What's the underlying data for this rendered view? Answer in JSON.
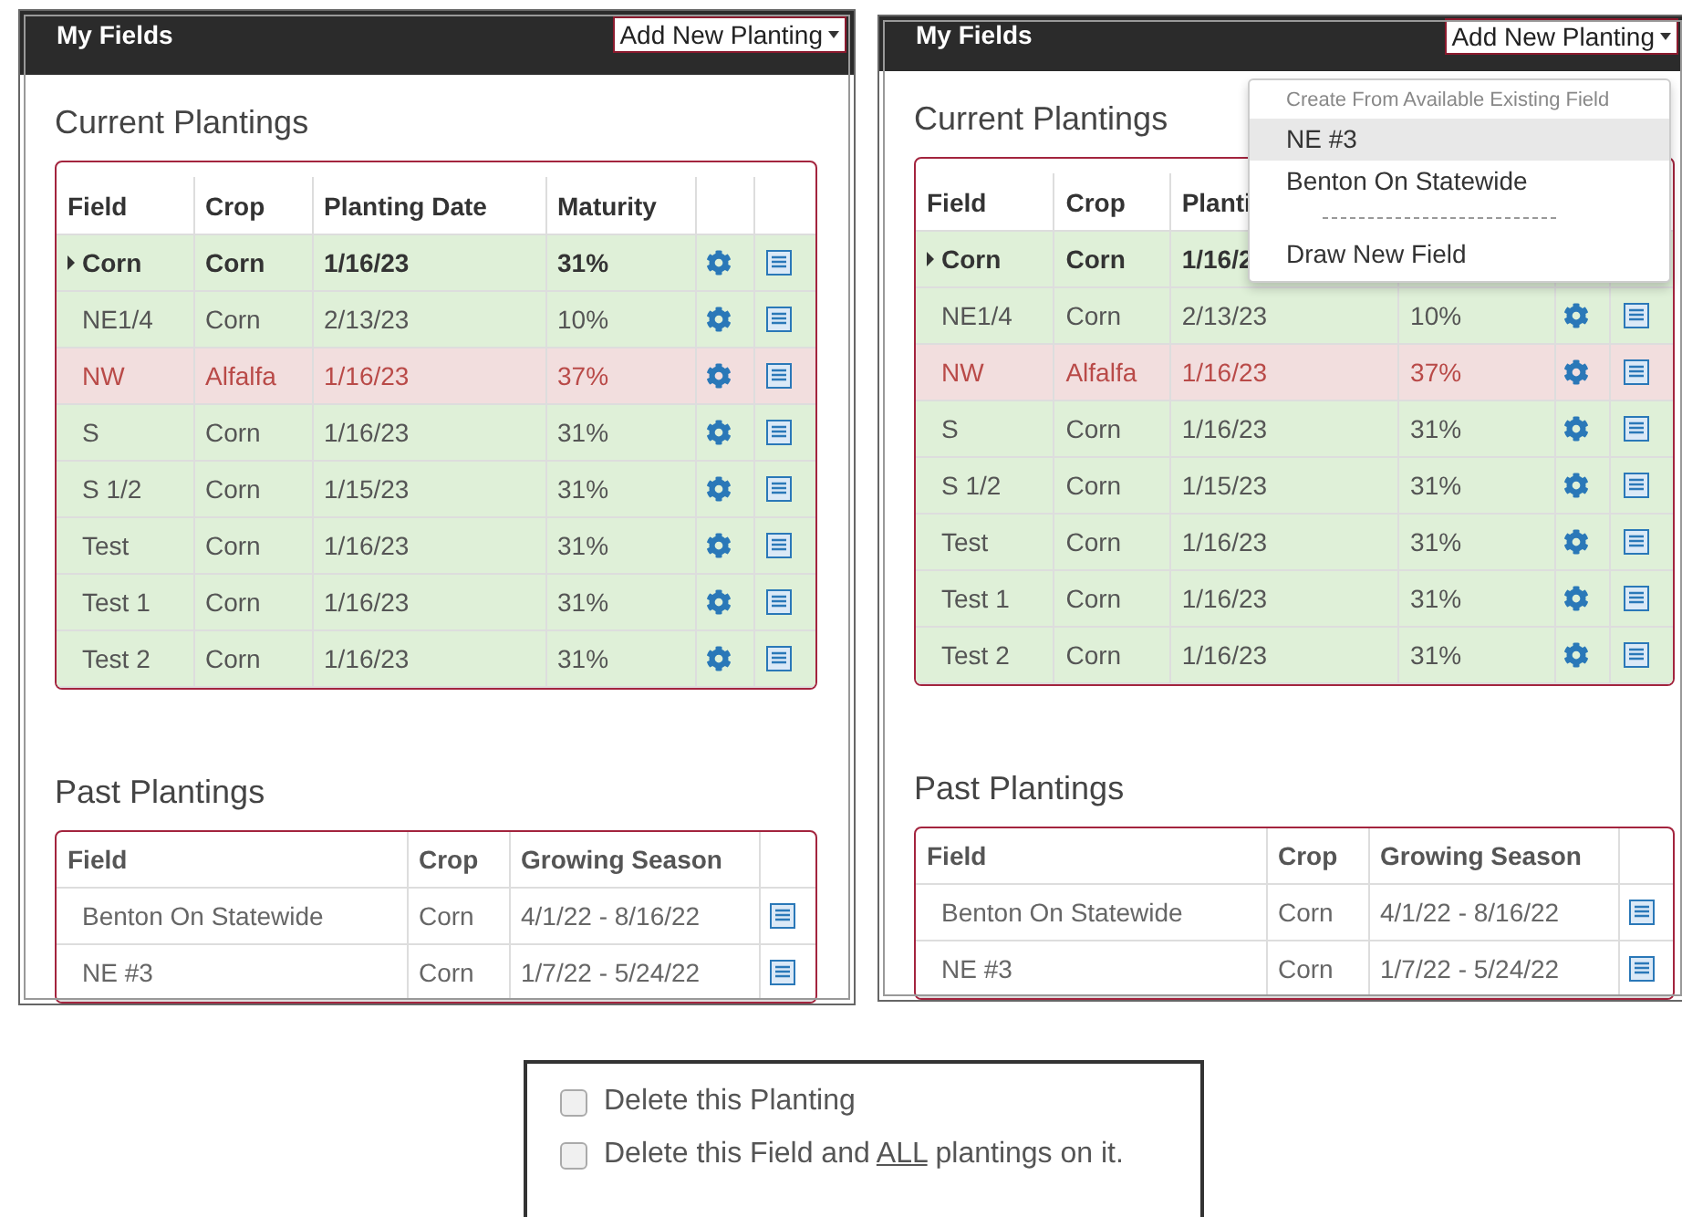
{
  "panels": [
    {
      "title": "My Fields",
      "add_button": "Add New Planting",
      "current": {
        "heading": "Current Plantings",
        "columns": [
          "Field",
          "Crop",
          "Planting Date",
          "Maturity"
        ],
        "rows": [
          {
            "field": "Corn",
            "crop": "Corn",
            "date": "1/16/23",
            "maturity": "31%",
            "color": "#dff0d8",
            "selected": true
          },
          {
            "field": "NE1/4",
            "crop": "Corn",
            "date": "2/13/23",
            "maturity": "10%",
            "color": "#dff0d8",
            "selected": false
          },
          {
            "field": "NW",
            "crop": "Alfalfa",
            "date": "1/16/23",
            "maturity": "37%",
            "color": "#f2dede",
            "selected": false
          },
          {
            "field": "S",
            "crop": "Corn",
            "date": "1/16/23",
            "maturity": "31%",
            "color": "#dff0d8",
            "selected": false
          },
          {
            "field": "S 1/2",
            "crop": "Corn",
            "date": "1/15/23",
            "maturity": "31%",
            "color": "#dff0d8",
            "selected": false
          },
          {
            "field": "Test",
            "crop": "Corn",
            "date": "1/16/23",
            "maturity": "31%",
            "color": "#dff0d8",
            "selected": false
          },
          {
            "field": "Test 1",
            "crop": "Corn",
            "date": "1/16/23",
            "maturity": "31%",
            "color": "#dff0d8",
            "selected": false
          },
          {
            "field": "Test 2",
            "crop": "Corn",
            "date": "1/16/23",
            "maturity": "31%",
            "color": "#dff0d8",
            "selected": false
          }
        ]
      },
      "past": {
        "heading": "Past Plantings",
        "columns": [
          "Field",
          "Crop",
          "Growing Season"
        ],
        "rows": [
          {
            "field": "Benton On Statewide",
            "crop": "Corn",
            "season": "4/1/22 - 8/16/22"
          },
          {
            "field": "NE #3",
            "crop": "Corn",
            "season": "1/7/22 - 5/24/22"
          }
        ]
      }
    },
    {
      "title": "My Fields",
      "add_button": "Add New Planting",
      "menu": {
        "items": [
          {
            "kind": "header",
            "label": "Create From Available Existing Field"
          },
          {
            "kind": "option",
            "label": "NE #3",
            "selected": true
          },
          {
            "kind": "option",
            "label": "Benton On Statewide",
            "selected": false
          },
          {
            "kind": "separator"
          },
          {
            "kind": "option",
            "label": "Draw New Field",
            "selected": false
          }
        ]
      },
      "current": {
        "heading": "Current Plantings",
        "columns": [
          "Field",
          "Crop",
          "Planti"
        ],
        "rows": [
          {
            "field": "Corn",
            "crop": "Corn",
            "date": "1/16/2",
            "color": "#dff0d8",
            "selected": true
          },
          {
            "field": "NE1/4",
            "crop": "Corn",
            "date": "2/13/23",
            "maturity": "10%",
            "color": "#dff0d8",
            "selected": false
          },
          {
            "field": "NW",
            "crop": "Alfalfa",
            "date": "1/16/23",
            "maturity": "37%",
            "color": "#f2dede",
            "selected": false
          },
          {
            "field": "S",
            "crop": "Corn",
            "date": "1/16/23",
            "maturity": "31%",
            "color": "#dff0d8",
            "selected": false
          },
          {
            "field": "S 1/2",
            "crop": "Corn",
            "date": "1/15/23",
            "maturity": "31%",
            "color": "#dff0d8",
            "selected": false
          },
          {
            "field": "Test",
            "crop": "Corn",
            "date": "1/16/23",
            "maturity": "31%",
            "color": "#dff0d8",
            "selected": false
          },
          {
            "field": "Test 1",
            "crop": "Corn",
            "date": "1/16/23",
            "maturity": "31%",
            "color": "#dff0d8",
            "selected": false
          },
          {
            "field": "Test 2",
            "crop": "Corn",
            "date": "1/16/23",
            "maturity": "31%",
            "color": "#dff0d8",
            "selected": false
          }
        ]
      },
      "past": {
        "heading": "Past Plantings",
        "columns": [
          "Field",
          "Crop",
          "Growing Season"
        ],
        "rows": [
          {
            "field": "Benton On Statewide",
            "crop": "Corn",
            "season": "4/1/22 - 8/16/22"
          },
          {
            "field": "NE #3",
            "crop": "Corn",
            "season": "1/7/22 - 5/24/22"
          }
        ]
      }
    }
  ],
  "dialog": {
    "options": [
      {
        "checked": false,
        "label": [
          {
            "text": "Delete this Planting"
          }
        ]
      },
      {
        "checked": false,
        "label": [
          {
            "text": "Delete this Field and "
          },
          {
            "text": "ALL",
            "underline": true
          },
          {
            "text": " plantings on it."
          }
        ]
      }
    ]
  }
}
